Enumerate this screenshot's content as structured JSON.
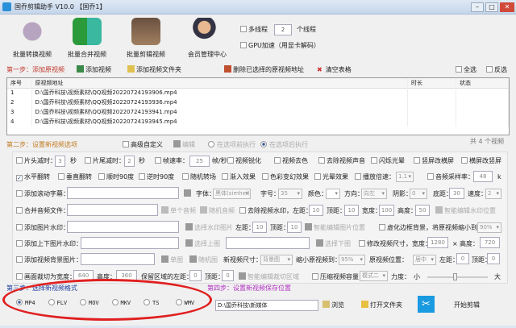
{
  "window": {
    "title": "国乔剪辑助手 V10.0  【国乔1】",
    "min": "–",
    "max": "□",
    "close": "✕"
  },
  "toolbar": {
    "items": [
      {
        "label": "批量转换视频"
      },
      {
        "label": "批量合并视频"
      },
      {
        "label": "批量剪辑视频"
      },
      {
        "label": "会员管理中心"
      }
    ],
    "multithread_label": "多线程",
    "threads": "2",
    "threads_unit": "个线程",
    "gpu_label": "GPU加速（用显卡解码）"
  },
  "step1": {
    "title": "第一步：添加原视频",
    "add_video": "添加视频",
    "add_folder": "添加视频文件夹",
    "delete_selected": "删除已选择的原视频地址",
    "clear_table": "清空表格",
    "select_all": "全选",
    "invert": "反选"
  },
  "table": {
    "columns": [
      "序号",
      "原视频地址",
      "时长",
      "状态"
    ],
    "rows": [
      [
        "1",
        "D:\\国乔科技\\视频素材\\QQ视频20220724193906.mp4",
        "",
        ""
      ],
      [
        "2",
        "D:\\国乔科技\\视频素材\\QQ视频20220724193936.mp4",
        "",
        ""
      ],
      [
        "3",
        "D:\\国乔科技\\视频素材\\QQ视频20220724193941.mp4",
        "",
        ""
      ],
      [
        "4",
        "D:\\国乔科技\\视频素材\\QQ视频20220724193945.mp4",
        "",
        ""
      ]
    ],
    "count": "共 4 个视频"
  },
  "step2": {
    "title": "第二步：设置新视频选项",
    "advanced": "高级自定义",
    "edit": "编辑",
    "before": "在选项前执行",
    "after": "在选项后执行",
    "head_cut": "片头减时：",
    "head_val": "3",
    "sec": "秒",
    "tail_cut": "片尾减时：",
    "tail_val": "2",
    "fps": "帧速率：",
    "fps_val": "25",
    "fps_unit": "帧/秒",
    "sharpen": "视频锐化",
    "decolor": "视频去色",
    "mute": "去除视频声音",
    "glow_flash": "闪烁光晕",
    "v2h": "竖屏改横屏",
    "h2v": "横屏改竖屏",
    "hflip": "水平翻转",
    "vflip": "垂直翻转",
    "cw90": "顺时90度",
    "ccw90": "逆时90度",
    "rand_trans": "随机转场",
    "fade_in": "渐入效果",
    "color_fx": "色彩变幻效果",
    "glow_fx": "光晕效果",
    "speed": "播放倍速：",
    "speed_val": "1.1",
    "sample_rate": "音频采样率：",
    "sample_val": "48",
    "sample_unit": "k",
    "subtitle": "添加滚动字幕：",
    "font": "字体：",
    "font_val": "黑体(simhei)",
    "size": "字号：",
    "size_val": "35",
    "color": "颜色：",
    "direction": "方向：",
    "direction_val": "向左",
    "shadow": "阴影：",
    "shadow_val": "0",
    "bottom": "底距：",
    "bottom_val": "30",
    "spd": "速度：",
    "spd_val": "2",
    "merge_audio": "合并音频文件：",
    "single_audio": "单个音频",
    "rand_audio": "随机音频",
    "remove_wm": "去除视频水印，左距：",
    "wm_left": "10",
    "top": "顶距：",
    "wm_top": "10",
    "width": "宽度：",
    "wm_w": "100",
    "height": "高度：",
    "wm_h": "50",
    "smart_wm": "智能编辑水印位置",
    "img_wm": "添加图片水印：",
    "choose_wm": "选择水印图片",
    "left": "左距：",
    "img_left": "10",
    "img_top": "10",
    "smart_img": "智能编辑图片位置",
    "blur_border": "虚化边框背景，将原视频缩小到：",
    "blur_val": "90%",
    "tb_wm": "添加上下图片水印：",
    "choose_top": "选择上图",
    "choose_bottom": "选择下图",
    "resize": "修改视频尺寸，宽度：",
    "resize_w": "1280",
    "times": "×",
    "height2": "高度：",
    "resize_h": "720",
    "bg_img": "添加视频背景图片：",
    "single_img": "单图",
    "rand_img": "随机图",
    "new_size": "新视频尺寸：",
    "new_size_val": "背景图",
    "shrink": "缩小原视频到：",
    "shrink_val": "95%",
    "pos": "原视频位置：",
    "pos_val": "居中",
    "pos_left": "0",
    "pos_top": "0",
    "crop": "画面裁切为宽度：",
    "crop_w": "640",
    "crop_h_label": "高度：",
    "crop_h": "360",
    "keep_left": "保留区域的左距：",
    "crop_left": "0",
    "crop_top": "0",
    "smart_crop": "智能编辑裁切区域",
    "compress": "压缩视频容量",
    "compress_val": "模式二",
    "strength": "力度：",
    "small": "小",
    "big": "大",
    "strength_value": 0.45
  },
  "step3": {
    "title": "第三步：选择新视频格式",
    "formats": [
      "MP4",
      "FLV",
      "MOV",
      "MKV",
      "TS",
      "WMV"
    ],
    "selected": "MP4"
  },
  "step4": {
    "title": "第四步：设置新视频保存位置",
    "path": "D:\\国乔科技\\新媒体",
    "browse": "浏览",
    "open_folder": "打开文件夹",
    "start": "开始剪辑"
  },
  "colors": {
    "step1": "#c0392b",
    "step2": "#c07a20",
    "step3": "#2040a0",
    "step4": "#b030c0",
    "annotation": "#e02020"
  }
}
